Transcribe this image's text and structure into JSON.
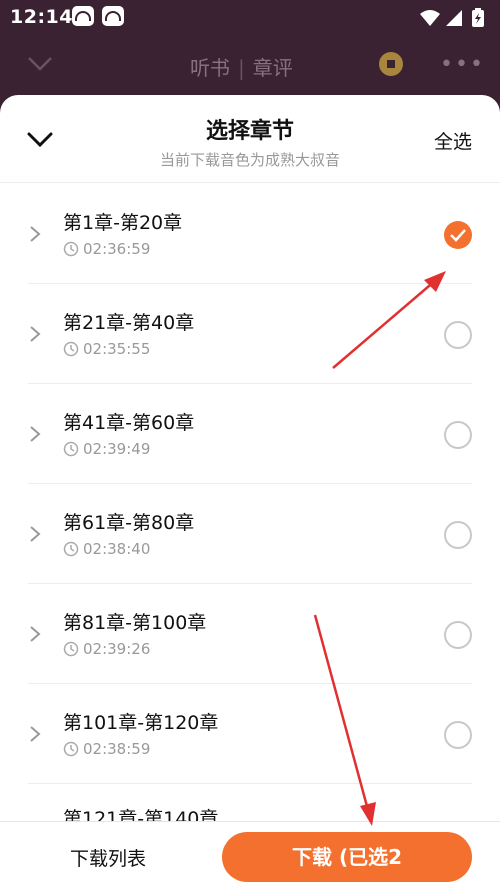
{
  "status_bar": {
    "time": "12:14"
  },
  "background_header": {
    "tab_listen": "听书",
    "tab_review": "章评",
    "more": "•••"
  },
  "sheet": {
    "title": "选择章节",
    "subtitle": "当前下载音色为成熟大叔音",
    "select_all_label": "全选",
    "close_icon": "chevron-down-icon"
  },
  "chapters": [
    {
      "title": "第1章-第20章",
      "duration": "02:36:59",
      "selected": true
    },
    {
      "title": "第21章-第40章",
      "duration": "02:35:55",
      "selected": false
    },
    {
      "title": "第41章-第60章",
      "duration": "02:39:49",
      "selected": false
    },
    {
      "title": "第61章-第80章",
      "duration": "02:38:40",
      "selected": false
    },
    {
      "title": "第81章-第100章",
      "duration": "02:39:26",
      "selected": false
    },
    {
      "title": "第101章-第120章",
      "duration": "02:38:59",
      "selected": false
    }
  ],
  "partial_item": {
    "title": "第121章-第140章"
  },
  "bottom_bar": {
    "download_list_label": "下载列表",
    "download_button_label": "下载 (已选2"
  },
  "colors": {
    "accent": "#f3702e",
    "annotation": "#e23030",
    "status_bar": "#3b2233"
  }
}
